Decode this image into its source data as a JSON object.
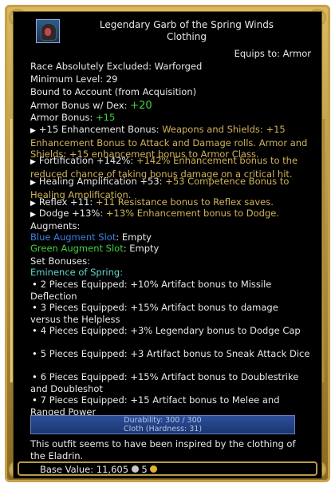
{
  "item": {
    "name": "Legendary Garb of the Spring Winds",
    "type": "Clothing",
    "equips": "Equips to: Armor",
    "race": "Race Absolutely Excluded: Warforged",
    "min_level": "Minimum Level: 29",
    "bound": "Bound to Account (from Acquisition)",
    "armor_dex_label": "Armor Bonus w/ Dex: ",
    "armor_dex_value": "+20",
    "armor_label": "Armor Bonus: ",
    "armor_value": "+15"
  },
  "effects": [
    {
      "name": "+15 Enhancement Bonus: ",
      "desc": "Weapons and Shields: +15 Enhancement Bonus to Attack and Damage rolls. Armor and Shields: +15 enhancement bonus to Armor Class."
    },
    {
      "name": "Fortification +142%: ",
      "desc": "+142% Enhancement bonus to the reduced chance of taking bonus damage on a critical hit."
    },
    {
      "name": "Healing Amplification +53: ",
      "desc": "+53 Competence Bonus to Healing Amplification."
    },
    {
      "name": "Reflex +11: ",
      "desc": "+11 Resistance bonus to Reflex saves."
    },
    {
      "name": "Dodge +13%: ",
      "desc": "+13% Enhancement bonus to Dodge."
    }
  ],
  "augments": {
    "label": "Augments:",
    "blue_label": "Blue Augment Slot",
    "blue_value": ": Empty",
    "green_label": "Green Augment Slot",
    "green_value": ": Empty"
  },
  "set": {
    "label": "Set Bonuses:",
    "name": "Eminence of Spring:",
    "bonuses": [
      "2 Pieces Equipped: +10% Artifact bonus to Missile Deflection",
      "3 Pieces Equipped: +15% Artifact bonus to damage versus the Helpless",
      "4 Pieces Equipped: +3% Legendary bonus to Dodge Cap",
      "5 Pieces Equipped: +3 Artifact bonus to Sneak Attack Dice",
      "6 Pieces Equipped: +15% Artifact bonus to Doublestrike and Doubleshot",
      "7 Pieces Equipped: +15 Artifact bonus to Melee and Ranged Power"
    ]
  },
  "durability": {
    "line1": "Durability: 300 / 300",
    "line2": "Cloth (Hardness: 31)",
    "fraction": 1.0
  },
  "flavor": "This outfit seems to have been inspired by the clothing of the Eladrin.",
  "footer": {
    "base_label": "Base Value: ",
    "platinum": "11,605",
    "gold": "5"
  },
  "icons": {
    "item_icon": "hooded-armor-icon",
    "platinum": "platinum-coin-icon",
    "gold": "gold-coin-icon"
  }
}
